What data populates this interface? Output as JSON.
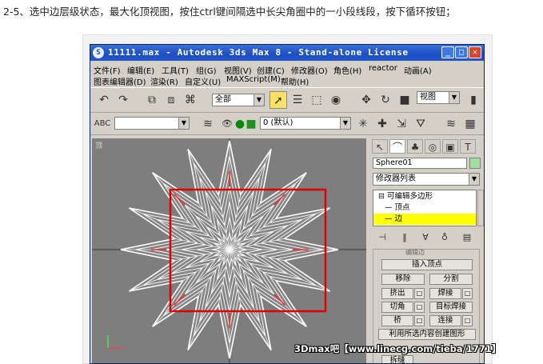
{
  "caption": "2-5、选中边层级状态，最大化顶视图，按住ctrl键间隔选中长尖角圈中的一小段线段，按下循环按钮；",
  "window": {
    "title": "11111.max - Autodesk 3ds Max 8 - Stand-alone License",
    "logo": "S"
  },
  "menu": {
    "row1": [
      "文件(F)",
      "编辑(E)",
      "工具(T)",
      "组(G)",
      "视图(V)",
      "创建(C)",
      "修改器(O)",
      "角色(H)",
      "reactor",
      "动画(A)"
    ],
    "row2": [
      "图表编辑器(D)",
      "渲染(R)",
      "自定义(U)",
      "MAXScript(M)",
      "帮助(H)"
    ]
  },
  "toolbar": {
    "selection_filter": "全部",
    "view_dropdown": "视图",
    "named_selection": "",
    "layer_dropdown": "0 (默认)"
  },
  "viewport": {
    "label": "顶",
    "colors": {
      "background": "#7e7e7e",
      "mesh": "#ffffff",
      "selected_edge": "#ff2020",
      "marquee": "#e00000"
    }
  },
  "panel": {
    "object_name": "Sphere01",
    "modifier_list": "修改器列表",
    "stack": {
      "root": "可编辑多边形",
      "items": [
        "顶点",
        "边"
      ],
      "active_index": 1
    },
    "rollout_header": "编辑边",
    "buttons": {
      "insert_vertex": "插入顶点",
      "remove": "移除",
      "split": "分割",
      "extrude": "挤出",
      "weld": "焊接",
      "chamfer": "切角",
      "target_weld": "目标焊接",
      "bridge": "桥",
      "connect": "连接",
      "create_shape": "利用所选内容创建图形",
      "more": "拆缝"
    }
  },
  "watermark": "3Dmax吧【www.linecg.com/tieba/1771】"
}
